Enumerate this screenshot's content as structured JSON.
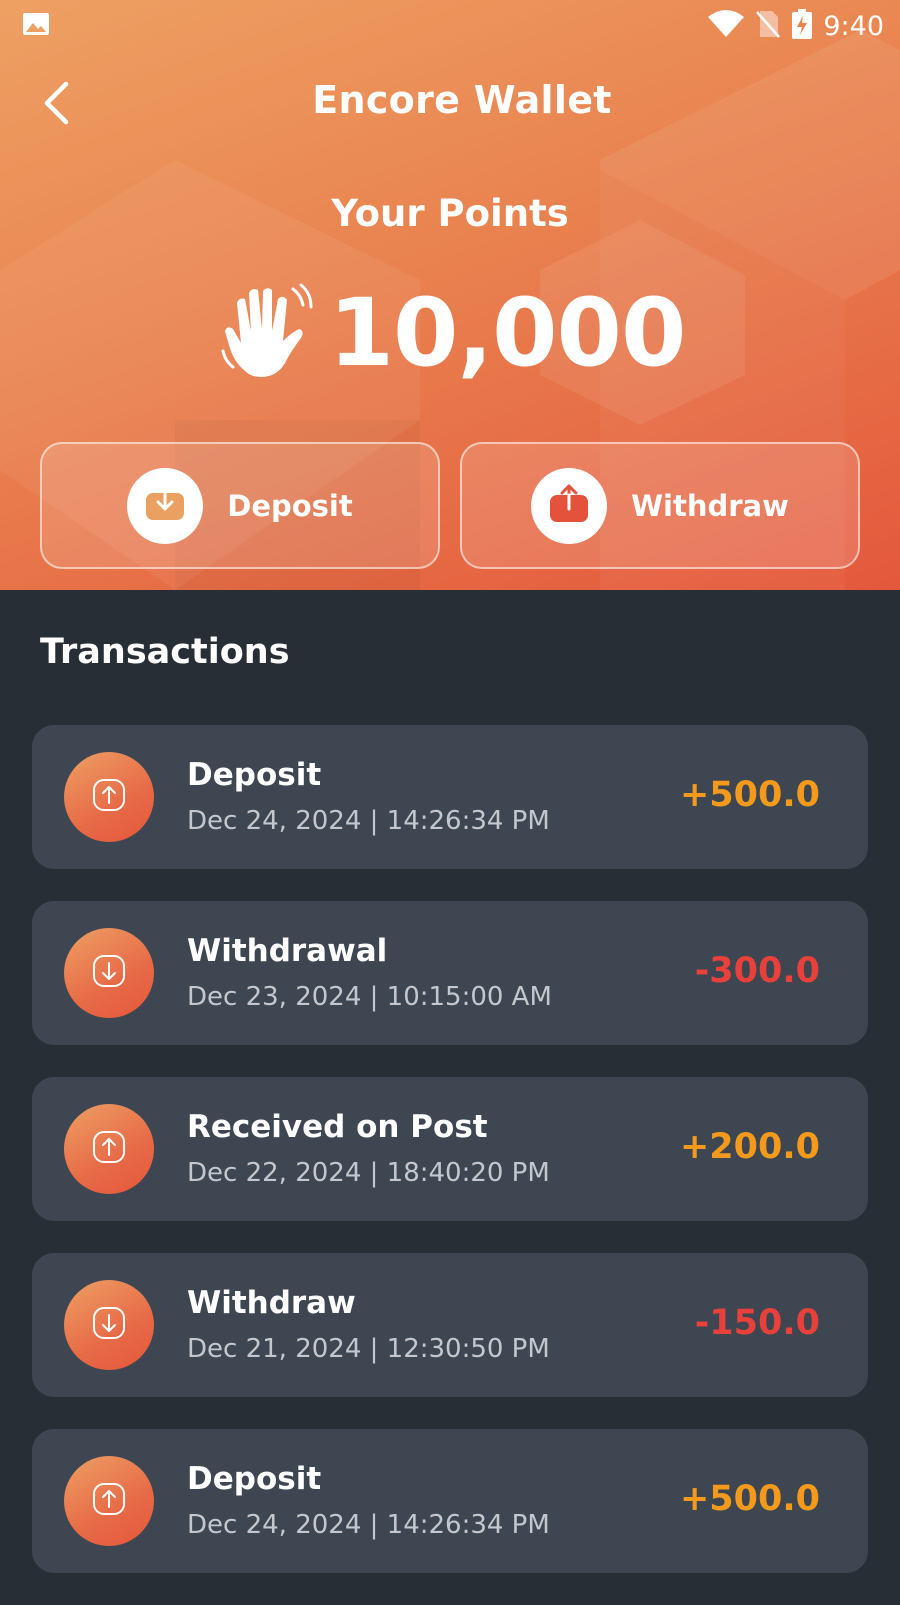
{
  "status_bar": {
    "time": "9:40"
  },
  "header": {
    "title": "Encore Wallet",
    "points_label": "Your Points",
    "points_value": "10,000"
  },
  "actions": {
    "deposit_label": "Deposit",
    "withdraw_label": "Withdraw"
  },
  "transactions": {
    "title": "Transactions",
    "items": [
      {
        "title": "Deposit",
        "date": "Dec 24, 2024 | 14:26:34 PM",
        "amount": "+500.0",
        "type": "credit"
      },
      {
        "title": "Withdrawal",
        "date": "Dec 23, 2024 | 10:15:00 AM",
        "amount": "-300.0",
        "type": "debit"
      },
      {
        "title": "Received on Post",
        "date": "Dec 22, 2024 | 18:40:20 PM",
        "amount": "+200.0",
        "type": "credit"
      },
      {
        "title": "Withdraw",
        "date": "Dec 21, 2024 | 12:30:50 PM",
        "amount": "-150.0",
        "type": "debit"
      },
      {
        "title": "Deposit",
        "date": "Dec 24, 2024 | 14:26:34 PM",
        "amount": "+500.0",
        "type": "credit"
      }
    ]
  },
  "colors": {
    "header_gradient_start": "#eea063",
    "header_gradient_end": "#e4583c",
    "background": "#282e35",
    "card": "#3e4651",
    "credit": "#f39a1c",
    "debit": "#e8403a"
  },
  "icons": {
    "status_image": "image-icon",
    "wifi": "wifi-icon",
    "no_sim": "no-sim-icon",
    "battery": "battery-charging-icon",
    "back": "chevron-left-icon",
    "points": "hand-wave-icon",
    "deposit": "tray-download-icon",
    "withdraw": "tray-upload-icon",
    "credit": "arrow-up-circle-icon",
    "debit": "arrow-down-circle-icon"
  }
}
